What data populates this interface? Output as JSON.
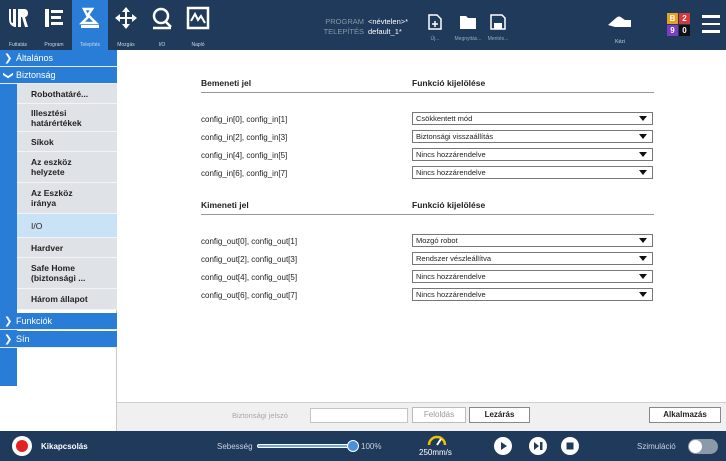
{
  "topbar": {
    "nav": [
      {
        "label": "Futtatás",
        "icon": "ur-logo-icon"
      },
      {
        "label": "Program",
        "icon": "program-icon"
      },
      {
        "label": "Telepítés",
        "icon": "installation-icon",
        "active": true
      },
      {
        "label": "Mozgás",
        "icon": "move-icon"
      },
      {
        "label": "I/O",
        "icon": "io-icon"
      },
      {
        "label": "Napló",
        "icon": "log-icon"
      }
    ],
    "program_key": "PROGRAM",
    "program_value": "<névtelen>*",
    "install_key": "TELEPÍTÉS",
    "install_value": "default_1*",
    "file_buttons": [
      {
        "label": "Új...",
        "icon": "new-file-icon"
      },
      {
        "label": "Megnyitás...",
        "icon": "open-folder-icon"
      },
      {
        "label": "Mentés...",
        "icon": "save-icon"
      }
    ],
    "hand_label": "Kézi",
    "badge": {
      "b": "B",
      "b_num": "2",
      "nine": "9",
      "zero": "0"
    }
  },
  "sidebar": {
    "general": "Általános",
    "safety": "Biztonság",
    "safety_items": [
      "Robothatáré...",
      "Illesztési\nhatárértékek",
      "Síkok",
      "Az eszköz\nhelyzete",
      "Az Eszköz\niránya",
      "I/O",
      "Hardver",
      "Safe Home\n(biztonsági ...",
      "Három állapot"
    ],
    "functions": "Funkciók",
    "rail": "Sín"
  },
  "inputs": {
    "col1_header": "Bemeneti jel",
    "col2_header": "Funkció kijelölése",
    "rows": [
      {
        "signal": "config_in[0], config_in[1]",
        "function": "Csökkentett mód"
      },
      {
        "signal": "config_in[2], config_in[3]",
        "function": "Biztonsági visszaállítás"
      },
      {
        "signal": "config_in[4], config_in[5]",
        "function": "Nincs hozzárendelve"
      },
      {
        "signal": "config_in[6], config_in[7]",
        "function": "Nincs hozzárendelve"
      }
    ]
  },
  "outputs": {
    "col1_header": "Kimeneti jel",
    "col2_header": "Funkció kijelölése",
    "rows": [
      {
        "signal": "config_out[0], config_out[1]",
        "function": "Mozgó robot"
      },
      {
        "signal": "config_out[2], config_out[3]",
        "function": "Rendszer vészleállítva"
      },
      {
        "signal": "config_out[4], config_out[5]",
        "function": "Nincs hozzárendelve"
      },
      {
        "signal": "config_out[6], config_out[7]",
        "function": "Nincs hozzárendelve"
      }
    ]
  },
  "bottom": {
    "password_label": "Biztonsági jelszó",
    "unlock": "Feloldás",
    "lock": "Lezárás",
    "apply": "Alkalmazás"
  },
  "footer": {
    "power_label": "Kikapcsolás",
    "speed_label": "Sebesség",
    "speed_value": "100%",
    "speed_fraction": 1.0,
    "tcp_speed": "250mm/s",
    "simulation_label": "Szimuláció",
    "simulation_on": false
  },
  "colors": {
    "topbar": "#1f3a5a",
    "accent": "#2a7dd6",
    "selected_item": "#c9e2f6",
    "sub_item": "#dfe2e6",
    "power_red": "#e52222",
    "badge_b": "#e8a020",
    "badge_2": "#d53a3a",
    "badge_9": "#7a3fc0",
    "badge_0": "#111111"
  }
}
